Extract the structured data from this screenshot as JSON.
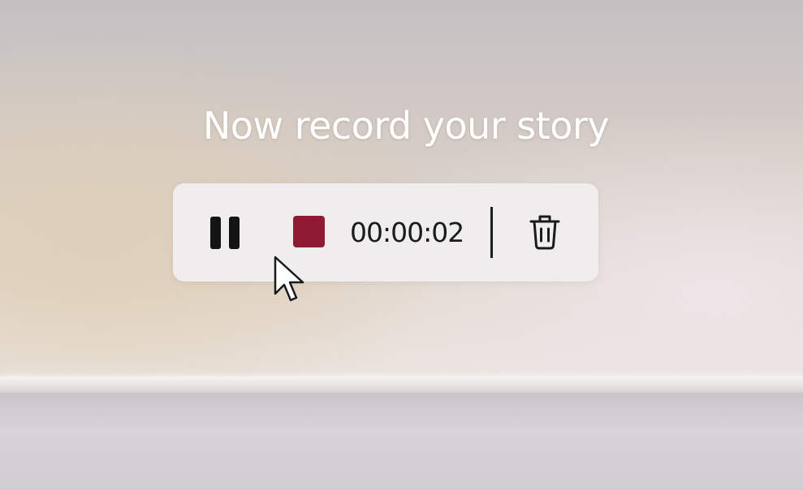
{
  "headline": "Now record your story",
  "recorder": {
    "timer": "00:00:02",
    "pause_icon": "pause-icon",
    "stop_icon": "stop-icon",
    "delete_icon": "trash-icon",
    "stop_color": "#8e1b34"
  },
  "cursor_icon": "mouse-pointer-icon"
}
